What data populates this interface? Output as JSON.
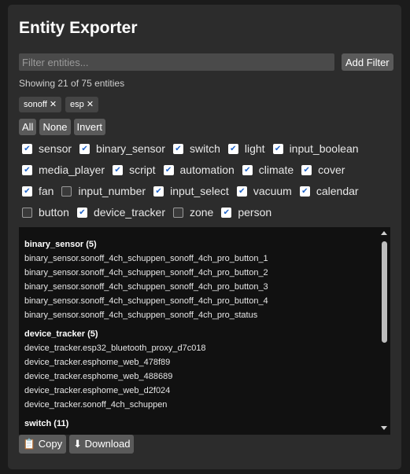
{
  "title": "Entity Exporter",
  "filter": {
    "placeholder": "Filter entities...",
    "add_label": "Add Filter"
  },
  "status": "Showing 21 of 75 entities",
  "chips": [
    {
      "label": "sonoff ✕"
    },
    {
      "label": "esp ✕"
    }
  ],
  "selection": {
    "all": "All",
    "none": "None",
    "invert": "Invert"
  },
  "domains": [
    {
      "label": "sensor",
      "checked": true
    },
    {
      "label": "binary_sensor",
      "checked": true
    },
    {
      "label": "switch",
      "checked": true
    },
    {
      "label": "light",
      "checked": true
    },
    {
      "label": "input_boolean",
      "checked": true
    },
    {
      "label": "media_player",
      "checked": true
    },
    {
      "label": "script",
      "checked": true
    },
    {
      "label": "automation",
      "checked": true
    },
    {
      "label": "climate",
      "checked": true
    },
    {
      "label": "cover",
      "checked": true
    },
    {
      "label": "fan",
      "checked": true
    },
    {
      "label": "input_number",
      "checked": false
    },
    {
      "label": "input_select",
      "checked": true
    },
    {
      "label": "vacuum",
      "checked": true
    },
    {
      "label": "calendar",
      "checked": true
    },
    {
      "label": "button",
      "checked": false
    },
    {
      "label": "device_tracker",
      "checked": true
    },
    {
      "label": "zone",
      "checked": false
    },
    {
      "label": "person",
      "checked": true
    }
  ],
  "groups": [
    {
      "header": "binary_sensor (5)",
      "items": [
        "binary_sensor.sonoff_4ch_schuppen_sonoff_4ch_pro_button_1",
        "binary_sensor.sonoff_4ch_schuppen_sonoff_4ch_pro_button_2",
        "binary_sensor.sonoff_4ch_schuppen_sonoff_4ch_pro_button_3",
        "binary_sensor.sonoff_4ch_schuppen_sonoff_4ch_pro_button_4",
        "binary_sensor.sonoff_4ch_schuppen_sonoff_4ch_pro_status"
      ]
    },
    {
      "header": "device_tracker (5)",
      "items": [
        "device_tracker.esp32_bluetooth_proxy_d7c018",
        "device_tracker.esphome_web_478f89",
        "device_tracker.esphome_web_488689",
        "device_tracker.esphome_web_d2f024",
        "device_tracker.sonoff_4ch_schuppen"
      ]
    },
    {
      "header": "switch (11)",
      "items": []
    }
  ],
  "actions": {
    "copy_icon": "clipboard-icon",
    "copy_label": "📋 Copy",
    "download_icon": "download-arrow-icon",
    "download_label": "⬇ Download"
  }
}
